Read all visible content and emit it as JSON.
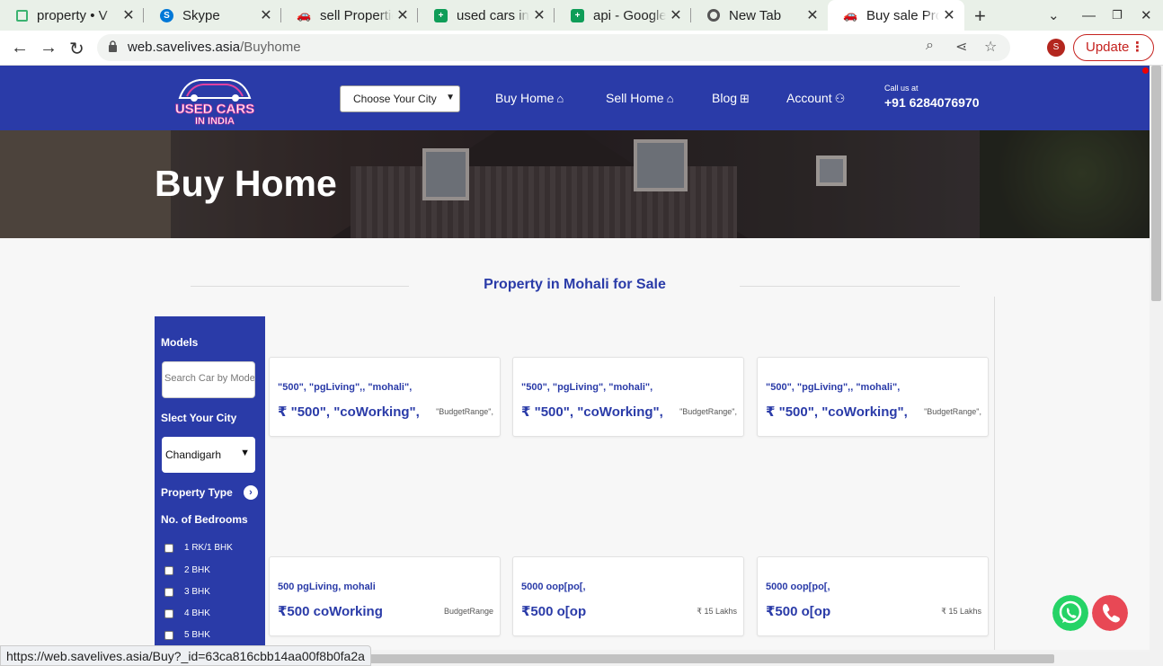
{
  "browser": {
    "tabs": [
      {
        "title": "property • V",
        "icon": "property-icon",
        "color": "#3cb371"
      },
      {
        "title": "Skype",
        "icon": "skype-icon",
        "color": "#0078d7"
      },
      {
        "title": "sell Properties",
        "icon": "car-icon",
        "color": "#555555"
      },
      {
        "title": "used cars in I",
        "icon": "sheets-icon",
        "color": "#0f9d58"
      },
      {
        "title": "api - Google S",
        "icon": "sheets-icon",
        "color": "#0f9d58"
      },
      {
        "title": "New Tab",
        "icon": "chrome-icon",
        "color": "#555555"
      },
      {
        "title": "Buy sale Prop",
        "icon": "car-icon",
        "color": "#7b3fa0"
      }
    ],
    "url_domain": "web.savelives.asia",
    "url_path": "/Buyhome",
    "profile_initial": "S",
    "update_label": "Update",
    "status_url": "https://web.savelives.asia/Buy?_id=63ca816cbb14aa00f8b0fa2a"
  },
  "header": {
    "logo_line1": "USED CARS",
    "logo_line2": "IN INDIA",
    "city_select": "Choose Your City",
    "nav": {
      "buy": "Buy Home",
      "sell": "Sell Home",
      "blog": "Blog",
      "account": "Account"
    },
    "call_label": "Call us at",
    "call_number": "+91 6284076970"
  },
  "hero": {
    "title": "Buy Home"
  },
  "section_title": "Property in Mohali for Sale",
  "filters": {
    "models_label": "Models",
    "search_placeholder": "Search Car by Model",
    "city_label": "Slect Your City",
    "city_value": "Chandigarh",
    "property_type_label": "Property Type",
    "bedrooms_label": "No. of Bedrooms",
    "bedrooms": [
      "1 RK/1 BHK",
      "2 BHK",
      "3 BHK",
      "4 BHK",
      "5 BHK"
    ]
  },
  "cards": [
    {
      "title": "\"500\", \"pgLiving\",, \"mohali\",",
      "price": "₹ \"500\", \"coWorking\",",
      "budget": "\"BudgetRange\","
    },
    {
      "title": "\"500\", \"pgLiving\", \"mohali\",",
      "price": "₹ \"500\", \"coWorking\",",
      "budget": "\"BudgetRange\","
    },
    {
      "title": "\"500\", \"pgLiving\",, \"mohali\",",
      "price": "₹ \"500\", \"coWorking\",",
      "budget": "\"BudgetRange\","
    },
    {
      "title": "500 pgLiving, mohali",
      "price": "₹500 coWorking",
      "budget": "BudgetRange"
    },
    {
      "title": "5000 oop[po[,",
      "price": "₹500 o[op",
      "budget": "₹ 15 Lakhs"
    },
    {
      "title": "5000 oop[po[,",
      "price": "₹500 o[op",
      "budget": "₹ 15 Lakhs"
    }
  ],
  "colors": {
    "brand": "#2a3ba8",
    "whatsapp": "#25d366",
    "phone": "#e84855"
  }
}
